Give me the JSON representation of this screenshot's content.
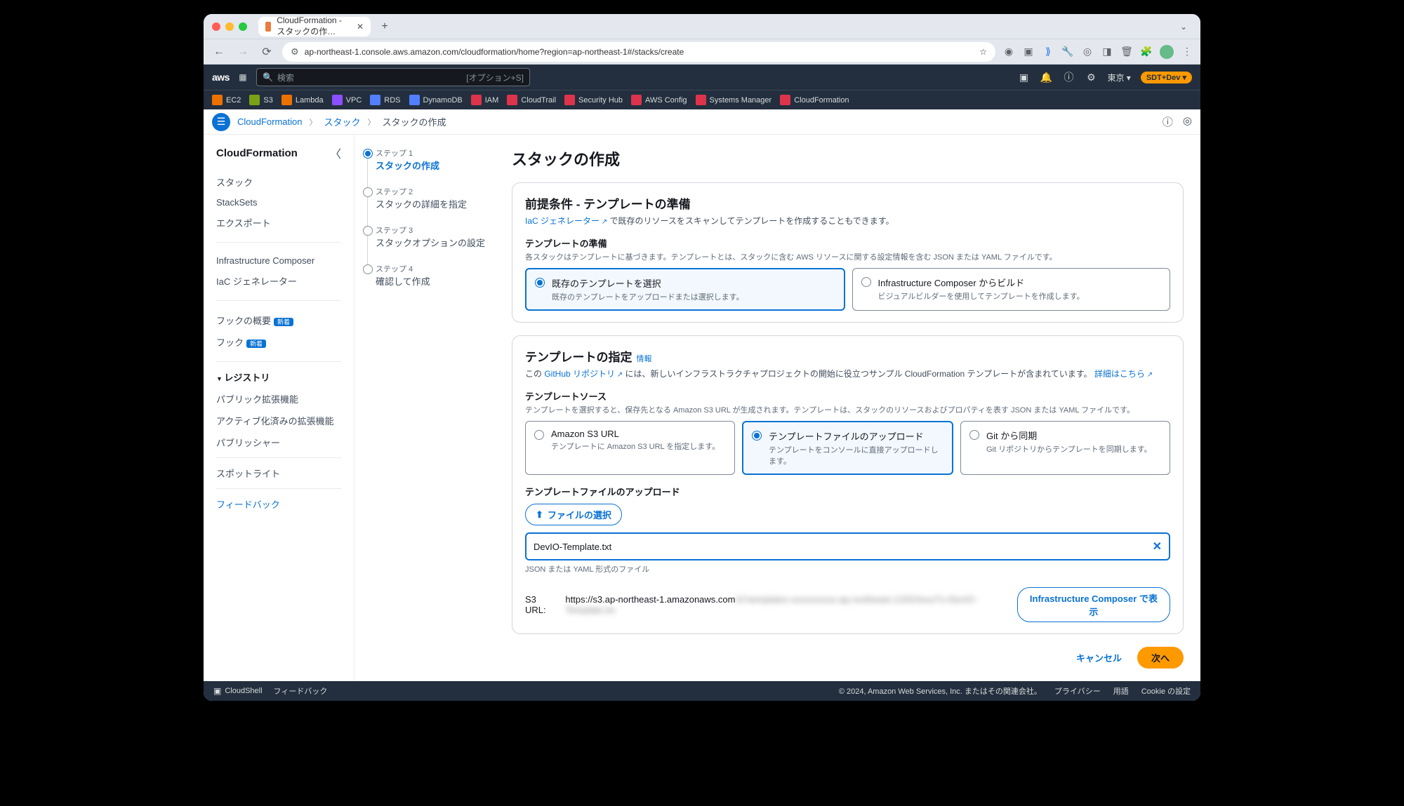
{
  "browser": {
    "tab_title": "CloudFormation - スタックの作…",
    "url": "ap-northeast-1.console.aws.amazon.com/cloudformation/home?region=ap-northeast-1#/stacks/create"
  },
  "aws_header": {
    "logo": "aws",
    "search_placeholder": "検索",
    "search_shortcut": "[オプション+S]",
    "region": "東京 ▾",
    "account": "SDT+Dev ▾"
  },
  "services": {
    "ec2": "EC2",
    "s3": "S3",
    "lambda": "Lambda",
    "vpc": "VPC",
    "rds": "RDS",
    "ddb": "DynamoDB",
    "iam": "IAM",
    "ct": "CloudTrail",
    "sh": "Security Hub",
    "cfg": "AWS Config",
    "sm": "Systems Manager",
    "cfn": "CloudFormation"
  },
  "breadcrumbs": {
    "a": "CloudFormation",
    "b": "スタック",
    "c": "スタックの作成"
  },
  "sidebar": {
    "title": "CloudFormation",
    "stacks": "スタック",
    "stacksets": "StackSets",
    "export": "エクスポート",
    "ic": "Infrastructure Composer",
    "iac": "IaC ジェネレーター",
    "hook_over": "フックの概要",
    "hook": "フック",
    "new": "新着",
    "registry": "レジストリ",
    "pub_ext": "パブリック拡張機能",
    "act_ext": "アクティブ化済みの拡張機能",
    "publisher": "パブリッシャー",
    "spotlight": "スポットライト",
    "feedback": "フィードバック"
  },
  "wizard": {
    "s1l": "ステップ 1",
    "s1t": "スタックの作成",
    "s2l": "ステップ 2",
    "s2t": "スタックの詳細を指定",
    "s3l": "ステップ 3",
    "s3t": "スタックオプションの設定",
    "s4l": "ステップ 4",
    "s4t": "確認して作成"
  },
  "page": {
    "title": "スタックの作成",
    "prereq_title": "前提条件 - テンプレートの準備",
    "prereq_link": "IaC ジェネレーター",
    "prereq_after": " で既存のリソースをスキャンしてテンプレートを作成することもできます。",
    "tpl_prep_label": "テンプレートの準備",
    "tpl_prep_help": "各スタックはテンプレートに基づきます。テンプレートとは、スタックに含む AWS リソースに関する設定情報を含む JSON または YAML ファイルです。",
    "r1_title": "既存のテンプレートを選択",
    "r1_desc": "既存のテンプレートをアップロードまたは選択します。",
    "r2_title": "Infrastructure Composer からビルド",
    "r2_desc": "ビジュアルビルダーを使用してテンプレートを作成します。",
    "spec_title": "テンプレートの指定",
    "spec_info": "情報",
    "spec_pre": "この ",
    "spec_link": "GitHub リポジトリ",
    "spec_mid": " には、新しいインフラストラクチャプロジェクトの開始に役立つサンプル CloudFormation テンプレートが含まれています。 ",
    "spec_detail": "詳細はこちら",
    "src_label": "テンプレートソース",
    "src_help": "テンプレートを選択すると、保存先となる Amazon S3 URL が生成されます。テンプレートは、スタックのリソースおよびプロパティを表す JSON または YAML ファイルです。",
    "src1_t": "Amazon S3 URL",
    "src1_d": "テンプレートに Amazon S3 URL を指定します。",
    "src2_t": "テンプレートファイルのアップロード",
    "src2_d": "テンプレートをコンソールに直接アップロードします。",
    "src3_t": "Git から同期",
    "src3_d": "Git リポジトリからテンプレートを同期します。",
    "upload_label": "テンプレートファイルのアップロード",
    "choose_file": "ファイルの選択",
    "filename": "DevIO-Template.txt",
    "file_hint": "JSON または YAML 形式のファイル",
    "s3_label": "S3 URL:",
    "s3_value": "https://s3.ap-northeast-1.amazonaws.com",
    "s3_hidden": "/cf-templates-xxxxxxxxxx-ap-northeast-1/2024xxxTx-DevIO-Template.txt",
    "ic_view": "Infrastructure Composer で表示",
    "cancel": "キャンセル",
    "next": "次へ"
  },
  "footer": {
    "cloudshell": "CloudShell",
    "feedback": "フィードバック",
    "copyright": "© 2024, Amazon Web Services, Inc. またはその関連会社。",
    "privacy": "プライバシー",
    "terms": "用語",
    "cookie": "Cookie の設定"
  }
}
